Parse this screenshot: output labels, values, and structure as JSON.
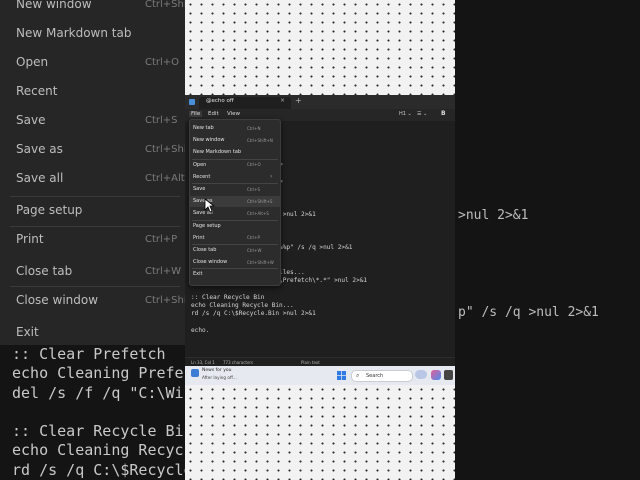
{
  "background": {
    "menu": [
      {
        "label": "New window",
        "shortcut": "Ctrl+Shi"
      },
      {
        "label": "New Markdown tab",
        "shortcut": ""
      },
      {
        "label": "Open",
        "shortcut": "Ctrl+O"
      },
      {
        "label": "Recent",
        "shortcut": ""
      },
      {
        "label": "Save",
        "shortcut": "Ctrl+S"
      },
      {
        "label": "Save as",
        "shortcut": "Ctrl+Shi"
      },
      {
        "label": "Save all",
        "shortcut": "Ctrl+Alt"
      },
      {
        "label": "Page setup",
        "shortcut": ""
      },
      {
        "label": "Print",
        "shortcut": "Ctrl+P"
      },
      {
        "label": "Close tab",
        "shortcut": "Ctrl+W"
      },
      {
        "label": "Close window",
        "shortcut": "Ctrl+Shi"
      },
      {
        "label": "Exit",
        "shortcut": ""
      }
    ],
    "code": [
      ":: Clear Prefetch",
      "echo Cleaning Prefe",
      "del /s /f /q \"C:\\Win",
      ":: Clear Recycle Bin",
      "echo Cleaning Recyc",
      "rd /s /q C:\\$Recycle"
    ],
    "right_fragments": [
      ">nul 2>&1",
      "p\" /s /q >nul 2>&1"
    ]
  },
  "window": {
    "tab_title": "@echo off",
    "tab_close": "×",
    "tab_add": "+"
  },
  "menubar": {
    "file": "File",
    "edit": "Edit",
    "view": "View",
    "heading": "H1 ⌄",
    "list": "☰ ⌄",
    "bold": "B"
  },
  "editor": {
    "lines": [
      "=========================",
      "ARTED",
      "=========================",
      "",
      "...",
      "\" >nul 2>&1",
      "*\") do rmdir \"%%p\" /s /q >nul 2>&1",
      "",
      "MP files...",
      "\\Temp\\*.*\" >nul 2>&1",
      "ws\\Temp\\*.*\") do rmdir \"%%p\" /s /q >nul 2>&1",
      "",
      ":: Clear Prefetch",
      "echo Cleaning Prefetch files...",
      "del /s /f /q \"C:\\Windows\\Prefetch\\*.*\" >nul 2>&1",
      "",
      ":: Clear Recycle Bin",
      "echo Cleaning Recycle Bin...",
      "rd /s /q C:\\$Recycle.Bin >nul 2>&1",
      "",
      "echo."
    ]
  },
  "file_menu": {
    "items": [
      {
        "label": "New tab",
        "shortcut": "Ctrl+N"
      },
      {
        "label": "New window",
        "shortcut": "Ctrl+Shift+N"
      },
      {
        "label": "New Markdown tab",
        "shortcut": ""
      },
      {
        "label": "Open",
        "shortcut": "Ctrl+O"
      },
      {
        "label": "Recent",
        "shortcut": "›"
      },
      {
        "label": "Save",
        "shortcut": "Ctrl+S"
      },
      {
        "label": "Save as",
        "shortcut": "Ctrl+Shift+S"
      },
      {
        "label": "Save all",
        "shortcut": "Ctrl+Alt+S"
      },
      {
        "label": "Page setup",
        "shortcut": ""
      },
      {
        "label": "Print",
        "shortcut": "Ctrl+P"
      },
      {
        "label": "Close tab",
        "shortcut": "Ctrl+W"
      },
      {
        "label": "Close window",
        "shortcut": "Ctrl+Shift+W"
      },
      {
        "label": "Exit",
        "shortcut": ""
      }
    ],
    "highlighted_index": 6
  },
  "statusbar": {
    "position": "Ln 33, Col 1",
    "characters": "773 characters",
    "format": "Plain text"
  },
  "taskbar": {
    "news_title": "News for you",
    "news_subtitle": "After laying off...",
    "search_label": "Search"
  }
}
